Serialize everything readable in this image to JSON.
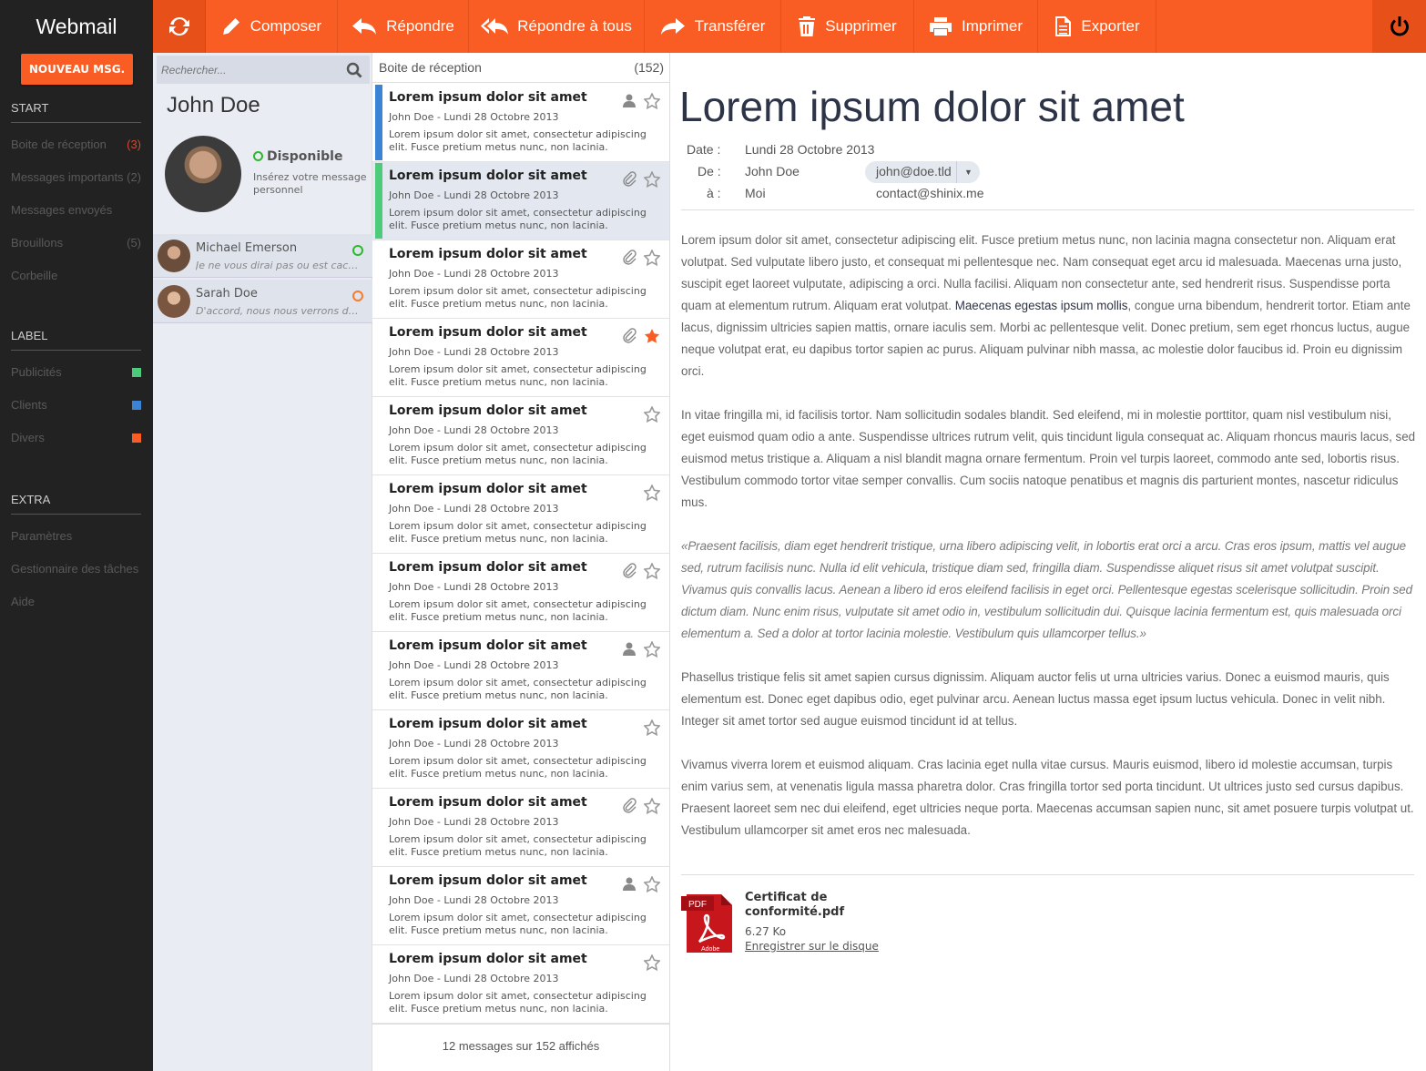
{
  "app": {
    "title": "Webmail",
    "new_message": "NOUVEAU MSG."
  },
  "sidebar": {
    "sections": [
      {
        "title": "START"
      },
      {
        "title": "LABEL"
      },
      {
        "title": "EXTRA"
      }
    ],
    "start_items": [
      {
        "label": "Boite de réception",
        "count": "(3)"
      },
      {
        "label": "Messages importants",
        "count": "(2)"
      },
      {
        "label": "Messages envoyés",
        "count": ""
      },
      {
        "label": "Brouillons",
        "count": "(5)"
      },
      {
        "label": "Corbeille",
        "count": ""
      }
    ],
    "labels": [
      {
        "label": "Publicités",
        "color": "#4ccc7a"
      },
      {
        "label": "Clients",
        "color": "#3b83d4"
      },
      {
        "label": "Divers",
        "color": "#fa5d23"
      }
    ],
    "extra_items": [
      {
        "label": "Paramètres"
      },
      {
        "label": "Gestionnaire des tâches"
      },
      {
        "label": "Aide"
      }
    ]
  },
  "toolbar": {
    "compose": "Composer",
    "reply": "Répondre",
    "reply_all": "Répondre à tous",
    "forward": "Transférer",
    "delete": "Supprimer",
    "print": "Imprimer",
    "export": "Exporter",
    "accent": "#fa5d23"
  },
  "contacts": {
    "search_placeholder": "Rechercher...",
    "user": {
      "name": "John Doe",
      "status": "Disponible",
      "personal_message": "Insérez votre message personnel"
    },
    "list": [
      {
        "name": "Michael Emerson",
        "excerpt": "Je ne vous dirai pas ou est cachée l...",
        "status_color": "#2bba2b"
      },
      {
        "name": "Sarah Doe",
        "excerpt": "D'accord, nous nous verrons dema...",
        "status_color": "#fa7a2a"
      }
    ]
  },
  "inbox": {
    "title": "Boite de réception",
    "count": "(152)",
    "footer": "12 messages sur 152 affichés",
    "messages": [
      {
        "subject": "Lorem ipsum dolor sit amet",
        "meta": "John Doe - Lundi 28 Octobre 2013",
        "preview": "Lorem ipsum dolor sit amet, consectetur adipiscing elit. Fusce pretium metus nunc, non lacinia.",
        "bar": "#3b83d4",
        "icon": "person",
        "starred": false,
        "selected": false
      },
      {
        "subject": "Lorem ipsum dolor sit amet",
        "meta": "John Doe - Lundi 28 Octobre 2013",
        "preview": "Lorem ipsum dolor sit amet, consectetur adipiscing elit. Fusce pretium metus nunc, non lacinia.",
        "bar": "#4ccc7a",
        "icon": "clip",
        "starred": false,
        "selected": true
      },
      {
        "subject": "Lorem ipsum dolor sit amet",
        "meta": "John Doe - Lundi 28 Octobre 2013",
        "preview": "Lorem ipsum dolor sit amet, consectetur adipiscing elit. Fusce pretium metus nunc, non lacinia.",
        "bar": "",
        "icon": "clip",
        "starred": false,
        "selected": false
      },
      {
        "subject": "Lorem ipsum dolor sit amet",
        "meta": "John Doe - Lundi 28 Octobre 2013",
        "preview": "Lorem ipsum dolor sit amet, consectetur adipiscing elit. Fusce pretium metus nunc, non lacinia.",
        "bar": "",
        "icon": "clip",
        "starred": true,
        "selected": false
      },
      {
        "subject": "Lorem ipsum dolor sit amet",
        "meta": "John Doe - Lundi 28 Octobre 2013",
        "preview": "Lorem ipsum dolor sit amet, consectetur adipiscing elit. Fusce pretium metus nunc, non lacinia.",
        "bar": "",
        "icon": "",
        "starred": false,
        "selected": false
      },
      {
        "subject": "Lorem ipsum dolor sit amet",
        "meta": "John Doe - Lundi 28 Octobre 2013",
        "preview": "Lorem ipsum dolor sit amet, consectetur adipiscing elit. Fusce pretium metus nunc, non lacinia.",
        "bar": "",
        "icon": "",
        "starred": false,
        "selected": false
      },
      {
        "subject": "Lorem ipsum dolor sit amet",
        "meta": "John Doe - Lundi 28 Octobre 2013",
        "preview": "Lorem ipsum dolor sit amet, consectetur adipiscing elit. Fusce pretium metus nunc, non lacinia.",
        "bar": "",
        "icon": "clip",
        "starred": false,
        "selected": false
      },
      {
        "subject": "Lorem ipsum dolor sit amet",
        "meta": "John Doe - Lundi 28 Octobre 2013",
        "preview": "Lorem ipsum dolor sit amet, consectetur adipiscing elit. Fusce pretium metus nunc, non lacinia.",
        "bar": "",
        "icon": "person",
        "starred": false,
        "selected": false
      },
      {
        "subject": "Lorem ipsum dolor sit amet",
        "meta": "John Doe - Lundi 28 Octobre 2013",
        "preview": "Lorem ipsum dolor sit amet, consectetur adipiscing elit. Fusce pretium metus nunc, non lacinia.",
        "bar": "",
        "icon": "",
        "starred": false,
        "selected": false
      },
      {
        "subject": "Lorem ipsum dolor sit amet",
        "meta": "John Doe - Lundi 28 Octobre 2013",
        "preview": "Lorem ipsum dolor sit amet, consectetur adipiscing elit. Fusce pretium metus nunc, non lacinia.",
        "bar": "",
        "icon": "clip",
        "starred": false,
        "selected": false
      },
      {
        "subject": "Lorem ipsum dolor sit amet",
        "meta": "John Doe - Lundi 28 Octobre 2013",
        "preview": "Lorem ipsum dolor sit amet, consectetur adipiscing elit. Fusce pretium metus nunc, non lacinia.",
        "bar": "",
        "icon": "person",
        "starred": false,
        "selected": false
      },
      {
        "subject": "Lorem ipsum dolor sit amet",
        "meta": "John Doe - Lundi 28 Octobre 2013",
        "preview": "Lorem ipsum dolor sit amet, consectetur adipiscing elit. Fusce pretium metus nunc, non lacinia.",
        "bar": "",
        "icon": "",
        "starred": false,
        "selected": false
      }
    ]
  },
  "reader": {
    "title": "Lorem ipsum dolor sit amet",
    "date_label": "Date :",
    "date": "Lundi 28 Octobre 2013",
    "from_label": "De :",
    "from_name": "John Doe",
    "from_email": "john@doe.tld",
    "to_label": "à :",
    "to_name": "Moi",
    "to_email": "contact@shinix.me",
    "p1a": "Lorem ipsum dolor sit amet, consectetur adipiscing elit. Fusce pretium metus nunc, non lacinia magna consectetur non. Aliquam erat volutpat. Sed vulputate libero justo, et consequat mi pellentesque nec. Nam consequat eget arcu id malesuada. Maecenas urna justo, suscipit eget laoreet vulputate, adipiscing a orci. Nulla facilisi. Aliquam non consectetur ante, sed hendrerit risus. Suspendisse porta quam at elementum rutrum. Aliquam erat volutpat. ",
    "p1_link": "Maecenas egestas ipsum mollis",
    "p1b": ", congue urna bibendum, hendrerit tortor. Etiam ante lacus, dignissim ultricies sapien mattis, ornare iaculis sem. Morbi ac pellentesque velit. Donec pretium, sem eget rhoncus luctus, augue neque volutpat erat, eu dapibus tortor sapien ac purus. Aliquam pulvinar nibh massa, ac molestie dolor faucibus id. Proin eu dignissim orci.",
    "p2": "In vitae fringilla mi, id facilisis tortor. Nam sollicitudin sodales blandit. Sed eleifend, mi in molestie porttitor, quam nisl vestibulum nisi, eget euismod quam odio a ante. Suspendisse ultrices rutrum velit, quis tincidunt ligula consequat ac. Aliquam rhoncus mauris lacus, sed euismod metus tristique a. Aliquam a nisl blandit magna ornare fermentum. Proin vel turpis laoreet, commodo ante sed, lobortis risus. Vestibulum commodo tortor vitae semper convallis. Cum sociis natoque penatibus et magnis dis parturient montes, nascetur ridiculus mus.",
    "quote": "«Praesent facilisis, diam eget hendrerit tristique, urna libero adipiscing velit, in lobortis erat orci a arcu. Cras eros ipsum, mattis vel augue sed, rutrum facilisis nunc. Nulla id elit vehicula, tristique diam sed, fringilla diam. Suspendisse aliquet risus sit amet volutpat suscipit. Vivamus quis convallis lacus. Aenean a libero id eros eleifend facilisis in eget orci. Pellentesque egestas scelerisque sollicitudin. Proin sed dictum diam. Nunc enim risus, vulputate sit amet odio in, vestibulum sollicitudin dui. Quisque lacinia fermentum est, quis malesuada orci elementum a. Sed a dolor at tortor lacinia molestie. Vestibulum quis ullamcorper tellus.»",
    "p3": "Phasellus tristique felis sit amet sapien cursus dignissim. Aliquam auctor felis ut urna ultricies varius. Donec a euismod mauris, quis elementum est. Donec eget dapibus odio, eget pulvinar arcu. Aenean luctus massa eget ipsum luctus vehicula. Donec in velit nibh. Integer sit amet tortor sed augue euismod tincidunt id at tellus.",
    "p4": "Vivamus viverra lorem et euismod aliquam. Cras lacinia eget nulla vitae cursus. Mauris euismod, libero id molestie accumsan, turpis enim varius sem, at venenatis ligula massa pharetra dolor. Cras fringilla tortor sed porta tincidunt. Ut ultrices justo sed cursus dapibus. Praesent laoreet sem nec dui eleifend, eget ultricies neque porta. Maecenas accumsan sapien nunc, sit amet posuere turpis volutpat ut. Vestibulum ullamcorper sit amet eros nec malesuada.",
    "attachment": {
      "name": "Certificat de conformité.pdf",
      "size": "6.27 Ko",
      "save": "Enregistrer sur le disque",
      "badge": "PDF",
      "brand": "Adobe"
    }
  }
}
